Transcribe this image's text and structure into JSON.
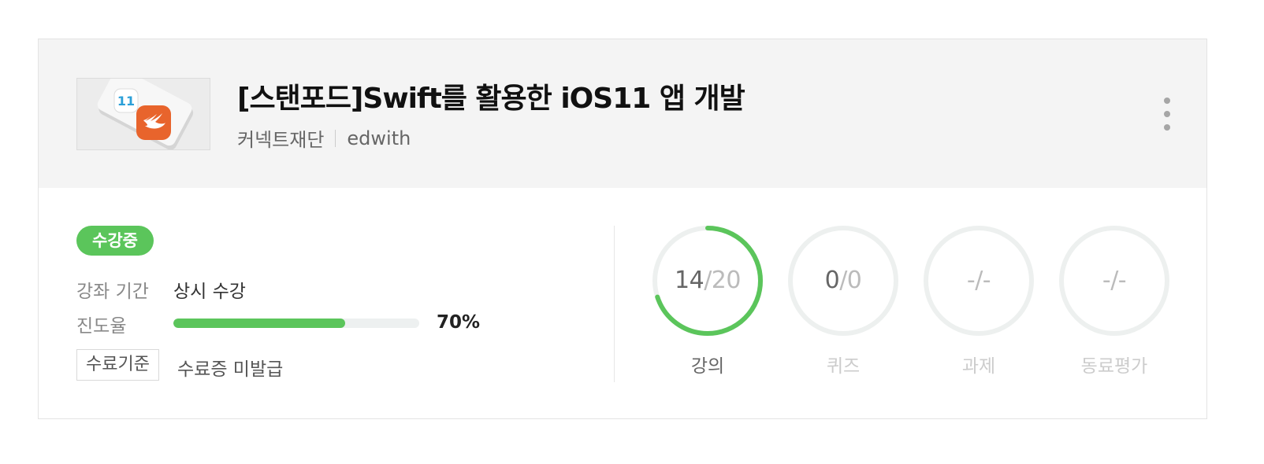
{
  "course": {
    "title": "[스탠포드]Swift를 활용한 iOS11 앱 개발",
    "provider": "커넥트재단",
    "platform": "edwith",
    "thumbnail_icon": "swift-logo-icon"
  },
  "enrollment": {
    "status": "수강중",
    "period_label": "강좌 기간",
    "period_value": "상시 수강",
    "progress_label": "진도율",
    "progress_percent": 70,
    "progress_text": "70%",
    "criteria_button": "수료기준",
    "certificate_status": "수료증 미발급"
  },
  "stats": [
    {
      "label": "강의",
      "value": "14",
      "total": "20",
      "ratio": 0.7,
      "active": true
    },
    {
      "label": "퀴즈",
      "value": "0",
      "total": "0",
      "ratio": 0,
      "active": false
    },
    {
      "label": "과제",
      "value": "-",
      "total": "-",
      "ratio": 0,
      "active": false
    },
    {
      "label": "동료평가",
      "value": "-",
      "total": "-",
      "ratio": 0,
      "active": false
    }
  ],
  "colors": {
    "accent": "#5bc55b",
    "track": "#edf0f0",
    "header_bg": "#f4f4f4"
  }
}
